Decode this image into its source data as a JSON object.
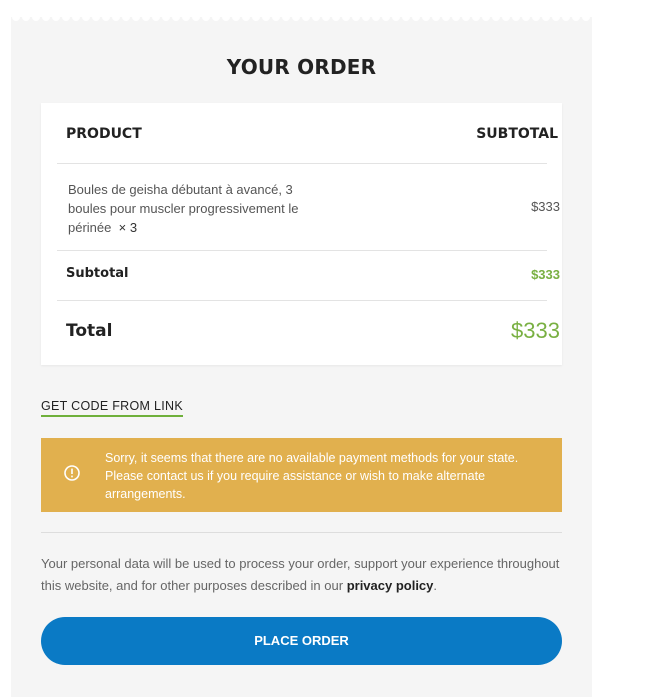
{
  "order": {
    "title": "YOUR ORDER",
    "header": {
      "product": "PRODUCT",
      "subtotal": "SUBTOTAL"
    },
    "item": {
      "name": "Boules de geisha débutant à avancé, 3 boules pour muscler progressivement le périnée",
      "quantity": "× 3",
      "price": "$333"
    },
    "subtotal": {
      "label": "Subtotal",
      "value": "$333"
    },
    "total": {
      "label": "Total",
      "value": "$333"
    }
  },
  "coupon": {
    "label": "GET CODE FROM LINK"
  },
  "notice": {
    "icon": "info-icon",
    "message": "Sorry, it seems that there are no available payment methods for your state. Please contact us if you require assistance or wish to make alternate arrangements."
  },
  "privacy": {
    "text": "Your personal data will be used to process your order, support your experience throughout this website, and for other purposes described in our",
    "link": "privacy policy",
    "suffix": "."
  },
  "place_order": {
    "label": "PLACE ORDER"
  },
  "colors": {
    "accent_green": "#79b042",
    "notice_bg": "#e1b04e",
    "button_blue": "#0a7ac5"
  }
}
